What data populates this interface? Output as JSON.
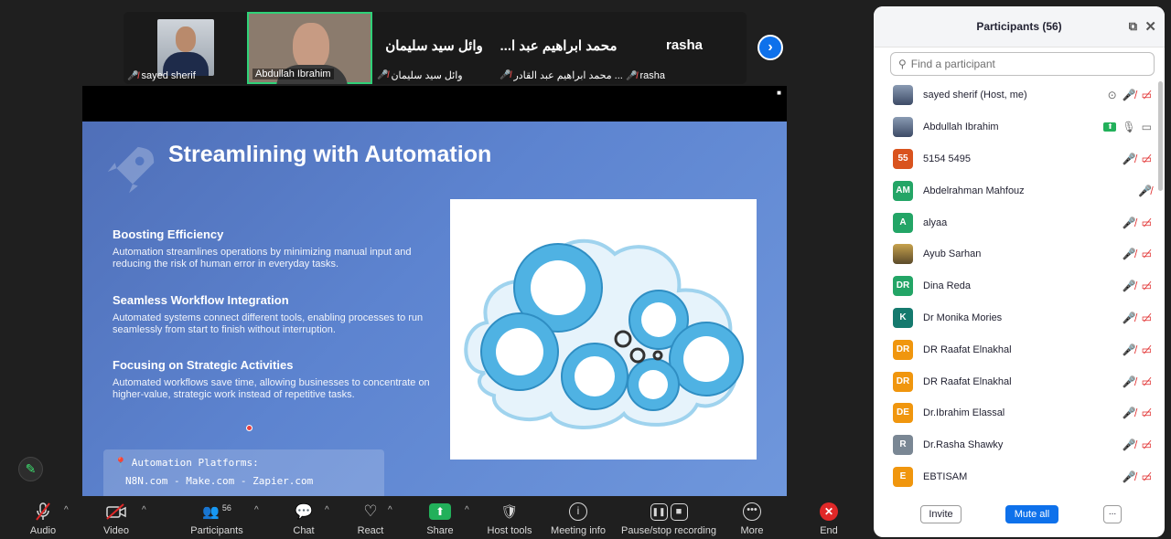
{
  "video_strip": {
    "tiles": [
      {
        "name": "sayed sherif"
      },
      {
        "name": "Abdullah Ibrahim"
      },
      {
        "name": "وائل سيد سليمان",
        "display": "وائل سيد سليمان"
      },
      {
        "name": "محمد ابراهيم عبد القادر ...",
        "display": "...محمد ابراهيم عبد ا"
      },
      {
        "name": "rasha",
        "display": "rasha"
      }
    ]
  },
  "slide": {
    "title": "Streamlining with Automation",
    "sections": [
      {
        "heading": "Boosting Efficiency",
        "body": "Automation streamlines operations by minimizing manual input and reducing the risk of human error in everyday tasks."
      },
      {
        "heading": "Seamless Workflow Integration",
        "body": "Automated systems connect different tools, enabling processes to run seamlessly from start to finish without interruption."
      },
      {
        "heading": "Focusing on Strategic Activities",
        "body": "Automated workflows save time, allowing businesses to concentrate on higher-value, strategic work instead of repetitive tasks."
      }
    ],
    "platforms_title": "Automation Platforms:",
    "platforms_list": "N8N.com - Make.com - Zapier.com"
  },
  "toolbar": {
    "audio": "Audio",
    "video": "Video",
    "participants": "Participants",
    "participants_count": "56",
    "chat": "Chat",
    "react": "React",
    "share": "Share",
    "host_tools": "Host tools",
    "meeting_info": "Meeting info",
    "recording": "Pause/stop recording",
    "more": "More",
    "end": "End"
  },
  "panel": {
    "title": "Participants (56)",
    "search_placeholder": "Find a participant",
    "participants": [
      {
        "name": "sayed sherif (Host, me)",
        "initials": "",
        "color": "#4a6fa5",
        "photo": true
      },
      {
        "name": "Abdullah Ibrahim",
        "initials": "",
        "color": "#6b7c93",
        "photo": true
      },
      {
        "name": "5154 5495",
        "initials": "55",
        "color": "#d9531e"
      },
      {
        "name": "Abdelrahman Mahfouz",
        "initials": "AM",
        "color": "#23a566"
      },
      {
        "name": "alyaa",
        "initials": "A",
        "color": "#23a566"
      },
      {
        "name": "Ayub Sarhan",
        "initials": "",
        "color": "#b58b2f",
        "photo2": true
      },
      {
        "name": "Dina Reda",
        "initials": "DR",
        "color": "#23a566"
      },
      {
        "name": "Dr Monika Mories",
        "initials": "K",
        "color": "#157a6e"
      },
      {
        "name": "DR Raafat Elnakhal",
        "initials": "DR",
        "color": "#f0960e"
      },
      {
        "name": "DR Raafat Elnakhal",
        "initials": "DR",
        "color": "#f0960e"
      },
      {
        "name": "Dr.Ibrahim Elassal",
        "initials": "DE",
        "color": "#f0960e"
      },
      {
        "name": "Dr.Rasha Shawky",
        "initials": "R",
        "color": "#7a8794"
      },
      {
        "name": "EBTISAM",
        "initials": "E",
        "color": "#f0960e"
      }
    ],
    "invite": "Invite",
    "mute_all": "Mute all",
    "more": "..."
  }
}
